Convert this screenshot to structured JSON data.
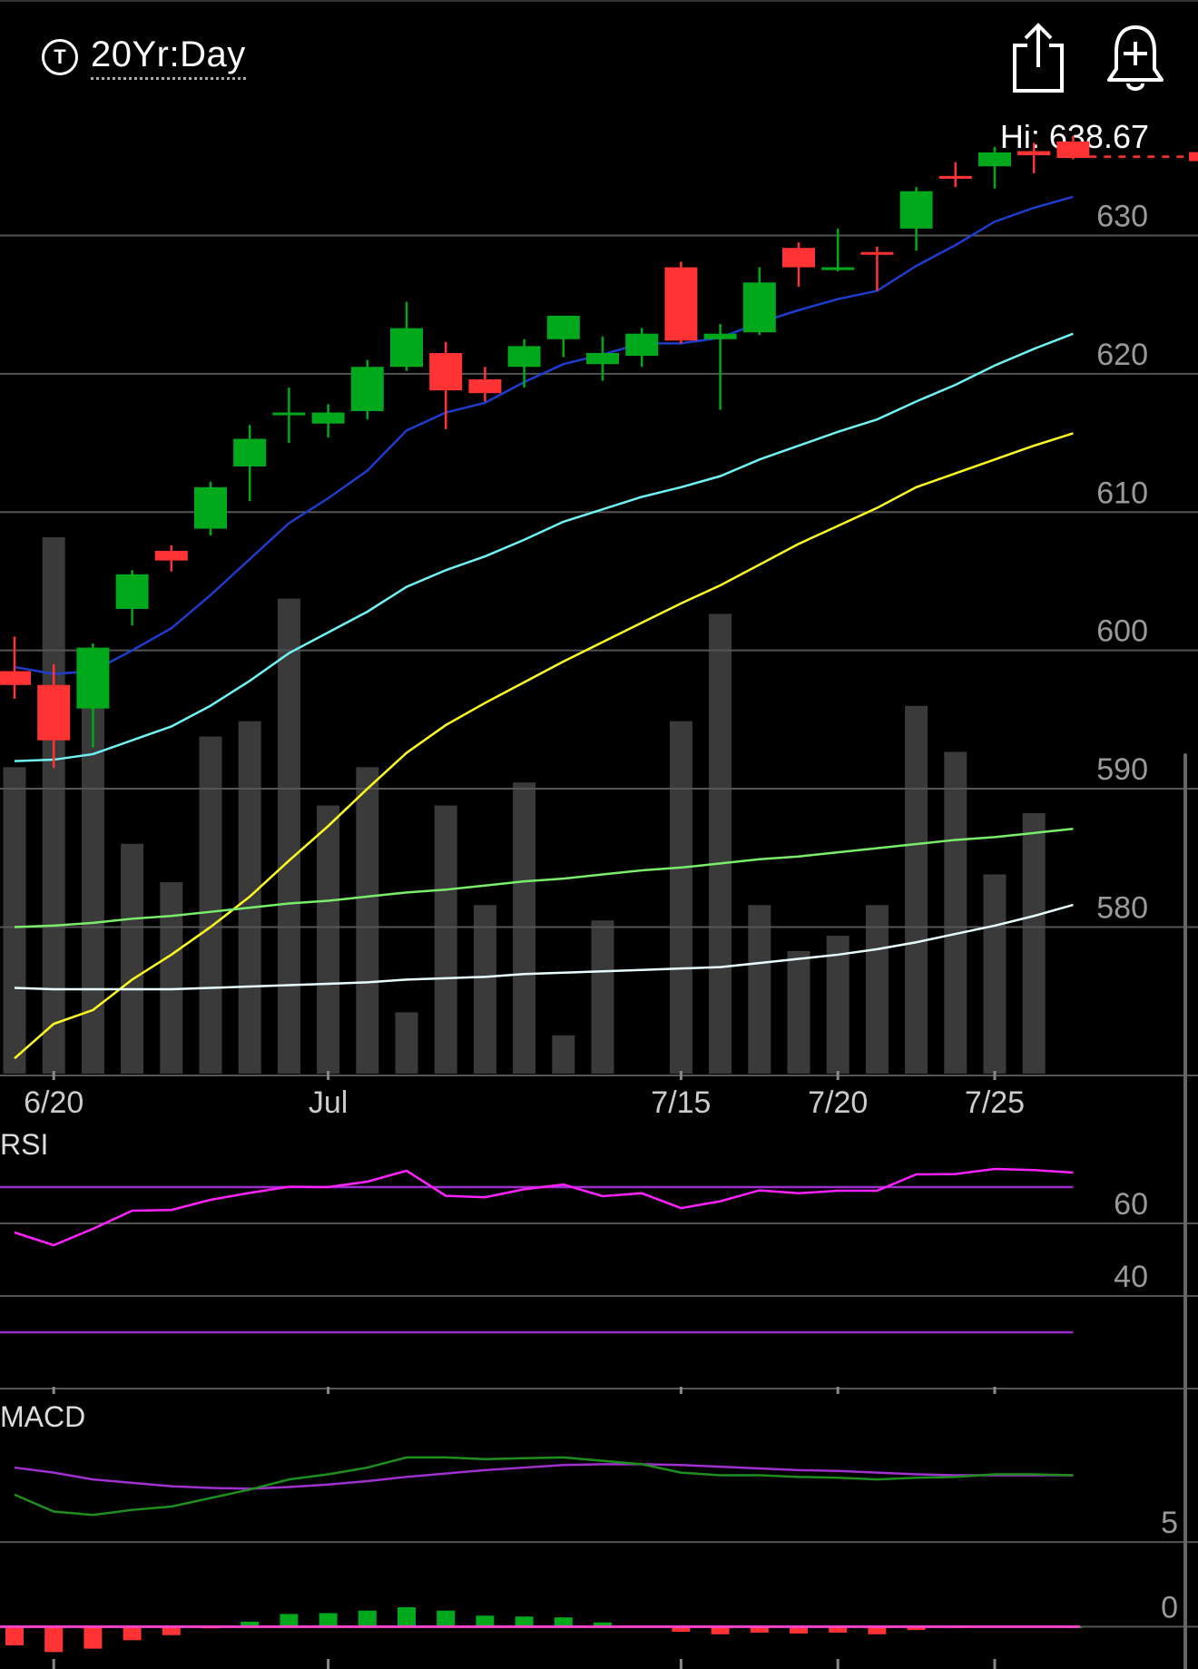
{
  "header": {
    "timeframe_icon": "T",
    "timeframe": "20Yr:Day",
    "hi_label": "Hi: 638.67",
    "share_icon": "share-icon",
    "alert_icon": "bell-plus-icon"
  },
  "colors": {
    "background": "#000000",
    "up": "#00a81c",
    "down": "#ff3333",
    "volume": "#3a3a3a",
    "ma1": "#1f3ccc",
    "ma2": "#6ff3f3",
    "ma3": "#ffff22",
    "ma4": "#7aee6a",
    "ma5": "#e8ffff",
    "rsi": "#ff22ff",
    "rsi_bands": "#9b2ecc",
    "macd": "#1e8f1e",
    "signal": "#a030d0",
    "hist_zero": "#ff44cc"
  },
  "chart_data": [
    {
      "type": "candlestick",
      "pane": "price",
      "x_labels": [
        {
          "index": 1,
          "label": "6/20"
        },
        {
          "index": 8,
          "label": "Jul"
        },
        {
          "index": 17,
          "label": "7/15"
        },
        {
          "index": 21,
          "label": "7/20"
        },
        {
          "index": 25,
          "label": "7/25"
        }
      ],
      "yticks": [
        580,
        590,
        600,
        610,
        620,
        630
      ],
      "ylim": [
        569.4,
        644.4
      ],
      "last_price": 635.7,
      "candles": [
        {
          "o": 598.5,
          "h": 601.0,
          "l": 596.5,
          "c": 597.5
        },
        {
          "o": 597.5,
          "h": 599.0,
          "l": 591.5,
          "c": 593.5
        },
        {
          "o": 595.8,
          "h": 600.5,
          "l": 593.0,
          "c": 600.2
        },
        {
          "o": 603.0,
          "h": 605.8,
          "l": 601.8,
          "c": 605.5
        },
        {
          "o": 607.2,
          "h": 607.6,
          "l": 605.7,
          "c": 606.5
        },
        {
          "o": 608.8,
          "h": 612.2,
          "l": 608.3,
          "c": 611.8
        },
        {
          "o": 613.3,
          "h": 616.3,
          "l": 610.8,
          "c": 615.3
        },
        {
          "o": 617.0,
          "h": 619.0,
          "l": 615.0,
          "c": 617.2
        },
        {
          "o": 616.4,
          "h": 617.8,
          "l": 615.4,
          "c": 617.2
        },
        {
          "o": 617.3,
          "h": 621.0,
          "l": 616.7,
          "c": 620.5
        },
        {
          "o": 620.5,
          "h": 625.2,
          "l": 620.2,
          "c": 623.3
        },
        {
          "o": 621.5,
          "h": 622.3,
          "l": 616.0,
          "c": 618.8
        },
        {
          "o": 619.6,
          "h": 620.5,
          "l": 618.0,
          "c": 618.6
        },
        {
          "o": 620.5,
          "h": 622.5,
          "l": 619.0,
          "c": 622.0
        },
        {
          "o": 622.5,
          "h": 623.6,
          "l": 621.2,
          "c": 624.2
        },
        {
          "o": 620.7,
          "h": 622.7,
          "l": 619.5,
          "c": 621.5
        },
        {
          "o": 621.3,
          "h": 623.3,
          "l": 620.5,
          "c": 622.9
        },
        {
          "o": 627.7,
          "h": 628.1,
          "l": 622.2,
          "c": 622.4
        },
        {
          "o": 622.5,
          "h": 623.6,
          "l": 617.4,
          "c": 622.9
        },
        {
          "o": 623.0,
          "h": 627.7,
          "l": 622.8,
          "c": 626.6
        },
        {
          "o": 629.1,
          "h": 629.5,
          "l": 626.3,
          "c": 627.7
        },
        {
          "o": 627.5,
          "h": 630.5,
          "l": 627.4,
          "c": 627.7
        },
        {
          "o": 628.8,
          "h": 629.2,
          "l": 626.0,
          "c": 628.7
        },
        {
          "o": 630.5,
          "h": 633.5,
          "l": 628.9,
          "c": 633.2
        },
        {
          "o": 634.3,
          "h": 635.3,
          "l": 633.5,
          "c": 634.1
        },
        {
          "o": 635.0,
          "h": 636.4,
          "l": 633.4,
          "c": 636.0
        },
        {
          "o": 636.1,
          "h": 636.7,
          "l": 634.5,
          "c": 635.8
        },
        {
          "o": 636.8,
          "h": 637.2,
          "l": 635.5,
          "c": 635.6
        }
      ],
      "volume": [
        580,
        610,
        595,
        570,
        565,
        584,
        586,
        602,
        575,
        580,
        548,
        575,
        562,
        578,
        545,
        560,
        528,
        586,
        600,
        562,
        556,
        558,
        562,
        588,
        582,
        566,
        574,
        523
      ],
      "moving_averages": [
        {
          "color_key": "ma1",
          "values": [
            598.8,
            598.3,
            598.5,
            600.0,
            601.6,
            604.0,
            606.6,
            609.2,
            611.0,
            613.0,
            615.9,
            617.2,
            617.9,
            619.4,
            620.7,
            621.4,
            622.2,
            622.2,
            622.6,
            623.7,
            624.6,
            625.4,
            626.0,
            627.8,
            629.3,
            631.0,
            632.0,
            632.8
          ]
        },
        {
          "color_key": "ma2",
          "values": [
            592.0,
            592.1,
            592.5,
            593.5,
            594.5,
            596.0,
            597.8,
            599.8,
            601.3,
            602.8,
            604.6,
            605.8,
            606.8,
            608.0,
            609.3,
            610.2,
            611.1,
            611.8,
            612.6,
            613.8,
            614.8,
            615.8,
            616.7,
            618.0,
            619.2,
            620.6,
            621.8,
            622.9
          ]
        },
        {
          "color_key": "ma3",
          "values": [
            570.5,
            573.0,
            574.0,
            576.2,
            578.0,
            580.0,
            582.2,
            584.8,
            587.3,
            590.0,
            592.6,
            594.6,
            596.2,
            597.7,
            599.2,
            600.6,
            602.0,
            603.4,
            604.7,
            606.2,
            607.7,
            609.0,
            610.3,
            611.8,
            612.8,
            613.8,
            614.8,
            615.7
          ]
        },
        {
          "color_key": "ma4",
          "values": [
            580.0,
            580.1,
            580.3,
            580.6,
            580.8,
            581.1,
            581.4,
            581.7,
            581.9,
            582.2,
            582.5,
            582.7,
            583.0,
            583.3,
            583.5,
            583.8,
            584.1,
            584.3,
            584.6,
            584.9,
            585.1,
            585.4,
            585.7,
            586.0,
            586.3,
            586.5,
            586.8,
            587.1
          ]
        },
        {
          "color_key": "ma5",
          "values": [
            575.6,
            575.5,
            575.5,
            575.5,
            575.5,
            575.6,
            575.7,
            575.8,
            575.9,
            576.0,
            576.2,
            576.3,
            576.4,
            576.6,
            576.7,
            576.8,
            576.9,
            577.0,
            577.1,
            577.4,
            577.7,
            578.0,
            578.4,
            578.9,
            579.5,
            580.1,
            580.8,
            581.6
          ]
        }
      ]
    },
    {
      "type": "line",
      "pane": "RSI",
      "title": "RSI",
      "yticks": [
        60,
        40
      ],
      "ylim": [
        15,
        80
      ],
      "bands": [
        70,
        30
      ],
      "values": [
        57.5,
        54.0,
        58.5,
        63.5,
        63.7,
        66.5,
        68.4,
        70.1,
        70.0,
        71.5,
        74.5,
        67.6,
        67.2,
        69.4,
        70.7,
        67.5,
        68.3,
        64.2,
        66.1,
        69.1,
        68.3,
        69.0,
        69.0,
        73.5,
        73.6,
        75.0,
        74.7,
        74.0
      ]
    },
    {
      "type": "line",
      "pane": "MACD",
      "title": "MACD",
      "yticks": [
        5,
        0
      ],
      "ylim": [
        -2.5,
        13.8
      ],
      "macd": [
        7.8,
        6.8,
        6.6,
        6.9,
        7.1,
        7.6,
        8.1,
        8.7,
        9.0,
        9.4,
        10.0,
        10.0,
        9.9,
        9.95,
        10.0,
        9.8,
        9.6,
        9.1,
        8.95,
        8.95,
        8.85,
        8.8,
        8.7,
        8.8,
        8.85,
        9.0,
        9.0,
        8.95
      ],
      "signal": [
        9.4,
        9.1,
        8.7,
        8.5,
        8.3,
        8.2,
        8.15,
        8.25,
        8.4,
        8.6,
        8.85,
        9.05,
        9.25,
        9.4,
        9.55,
        9.6,
        9.6,
        9.55,
        9.45,
        9.35,
        9.25,
        9.2,
        9.1,
        9.0,
        8.95,
        8.95,
        8.95,
        8.95
      ],
      "histogram": [
        -1.1,
        -1.5,
        -1.3,
        -0.8,
        -0.5,
        -0.1,
        0.3,
        0.75,
        0.8,
        0.95,
        1.15,
        0.95,
        0.65,
        0.6,
        0.55,
        0.25,
        0.05,
        -0.3,
        -0.45,
        -0.35,
        -0.4,
        -0.35,
        -0.45,
        -0.2,
        -0.05,
        0.05,
        0.05,
        0.0
      ]
    }
  ]
}
